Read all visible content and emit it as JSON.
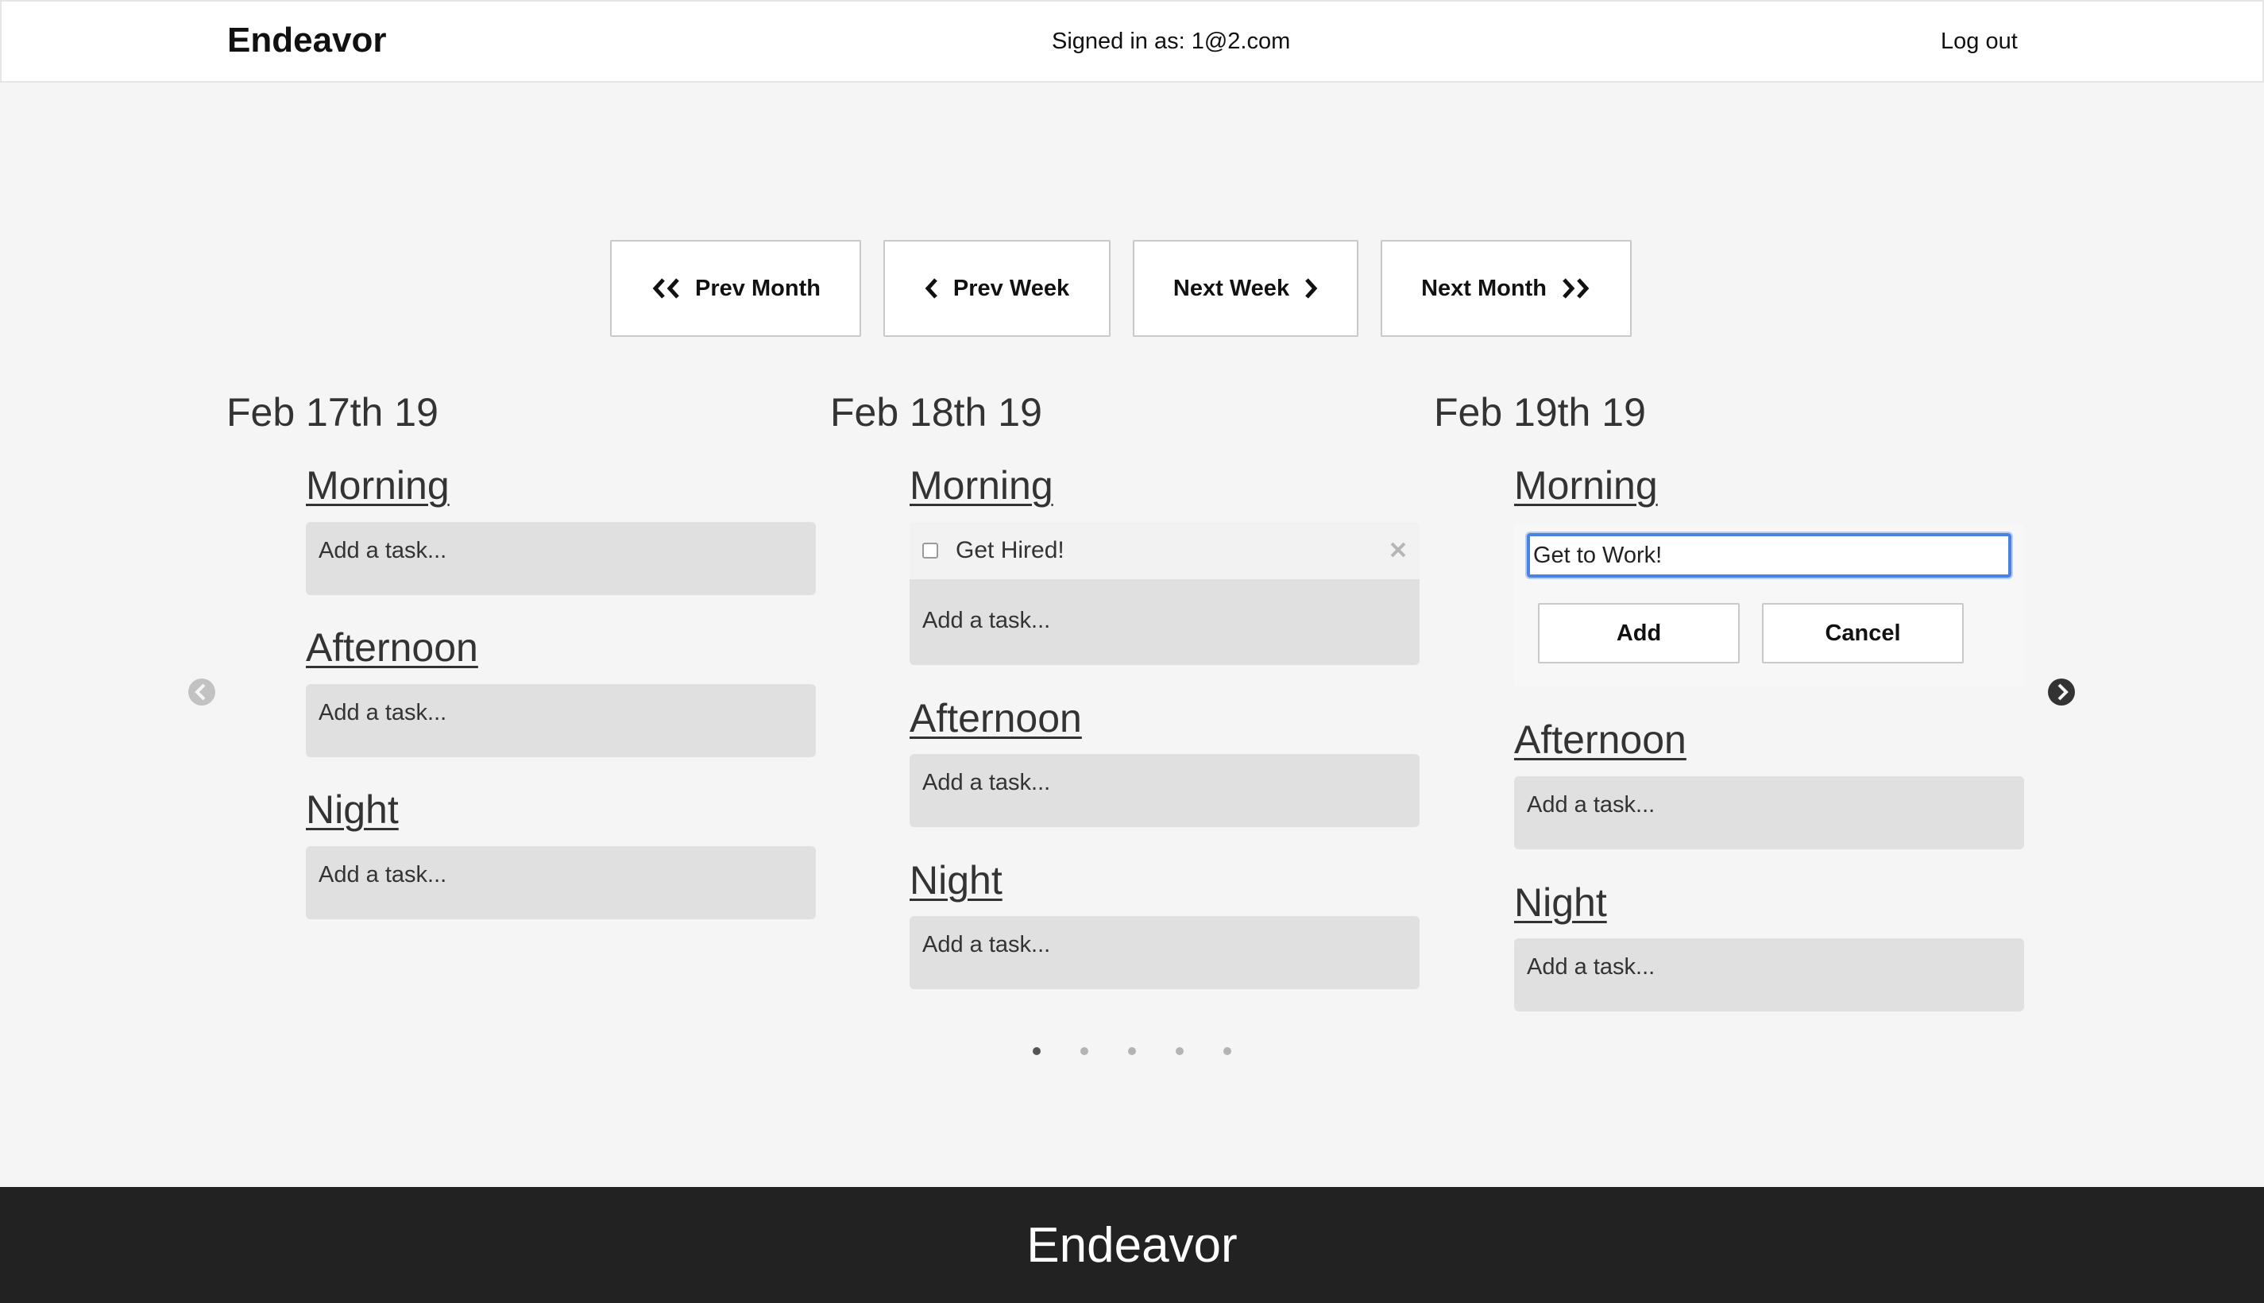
{
  "header": {
    "brand": "Endeavor",
    "signed_in": "Signed in as: 1@2.com",
    "logout": "Log out"
  },
  "nav": {
    "prev_month": "Prev Month",
    "prev_week": "Prev Week",
    "next_week": "Next Week",
    "next_month": "Next Month"
  },
  "days": [
    {
      "title": "Feb 17th 19",
      "periods": [
        {
          "label": "Morning",
          "placeholder": "Add a task..."
        },
        {
          "label": "Afternoon",
          "placeholder": "Add a task..."
        },
        {
          "label": "Night",
          "placeholder": "Add a task..."
        }
      ]
    },
    {
      "title": "Feb 18th 19",
      "periods": [
        {
          "label": "Morning",
          "tasks": [
            "Get Hired!"
          ],
          "placeholder": "Add a task..."
        },
        {
          "label": "Afternoon",
          "placeholder": "Add a task..."
        },
        {
          "label": "Night",
          "placeholder": "Add a task..."
        }
      ]
    },
    {
      "title": "Feb 19th 19",
      "periods": [
        {
          "label": "Morning",
          "input_value": "Get to Work!",
          "add_label": "Add",
          "cancel_label": "Cancel"
        },
        {
          "label": "Afternoon",
          "placeholder": "Add a task..."
        },
        {
          "label": "Night",
          "placeholder": "Add a task..."
        }
      ]
    }
  ],
  "carousel": {
    "page_count": 5,
    "active_page": 1
  },
  "footer": {
    "brand": "Endeavor"
  },
  "colors": {
    "background": "#f5f5f5",
    "task_box": "#e0e0e0",
    "footer": "#222222",
    "focus_ring": "#4a82e0"
  }
}
